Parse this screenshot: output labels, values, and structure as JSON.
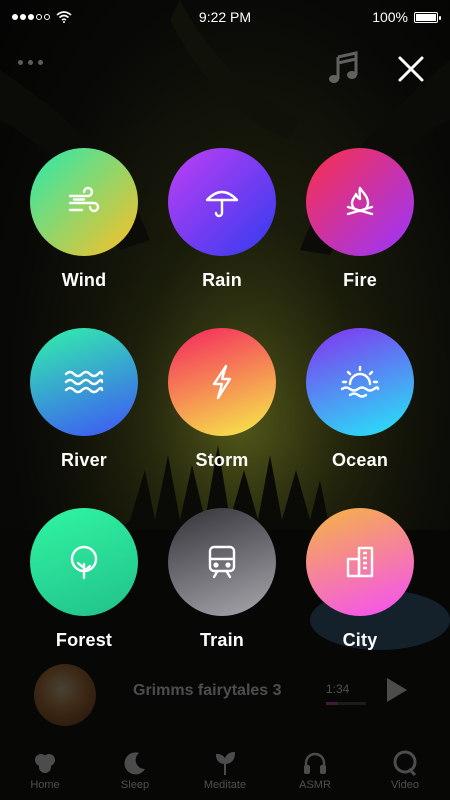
{
  "status_bar": {
    "time": "9:22 PM",
    "battery": "100%"
  },
  "top_bar": {
    "more_icon": "ellipsis-icon",
    "music_icon": "music-note-icon",
    "close_icon": "close-icon"
  },
  "sounds": [
    {
      "label": "Wind",
      "icon": "wind-icon",
      "gradient": [
        "#3ee6a0",
        "#e9c331"
      ]
    },
    {
      "label": "Rain",
      "icon": "umbrella-icon",
      "gradient": [
        "#b23ef4",
        "#3f3bf0"
      ]
    },
    {
      "label": "Fire",
      "icon": "campfire-icon",
      "gradient": [
        "#f2305a",
        "#a235f0"
      ]
    },
    {
      "label": "River",
      "icon": "waves-icon",
      "gradient": [
        "#32e3b0",
        "#3d63f1"
      ]
    },
    {
      "label": "Storm",
      "icon": "lightning-icon",
      "gradient": [
        "#f5385d",
        "#f7e54a"
      ]
    },
    {
      "label": "Ocean",
      "icon": "sunset-icon",
      "gradient": [
        "#7a43f1",
        "#2cd8f6"
      ]
    },
    {
      "label": "Forest",
      "icon": "tree-icon",
      "gradient": [
        "#2ef0a0",
        "#23c68c"
      ]
    },
    {
      "label": "Train",
      "icon": "train-icon",
      "gradient": [
        "#4c4c52",
        "#a2a2a8"
      ]
    },
    {
      "label": "City",
      "icon": "building-icon",
      "gradient": [
        "#f54ff0",
        "#f8b24c"
      ]
    }
  ],
  "player": {
    "title": "Grimms fairytales 3",
    "time": "1:34",
    "progress": 0.3
  },
  "nav": [
    {
      "label": "Home",
      "icon": "home-icon"
    },
    {
      "label": "Sleep",
      "icon": "moon-icon"
    },
    {
      "label": "Meditate",
      "icon": "sprout-icon"
    },
    {
      "label": "ASMR",
      "icon": "headphones-icon"
    },
    {
      "label": "Video",
      "icon": "video-icon"
    }
  ]
}
